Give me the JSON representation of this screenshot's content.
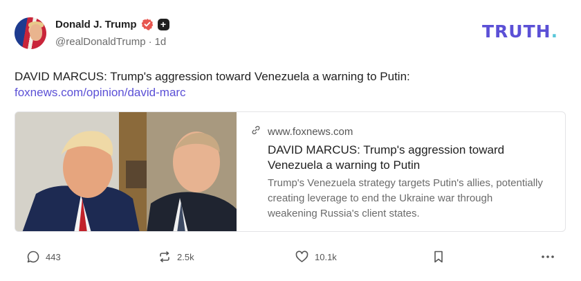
{
  "post": {
    "author_name": "Donald J. Trump",
    "handle": "@realDonaldTrump",
    "separator": "·",
    "age": "1d",
    "text": "DAVID MARCUS: Trump's aggression toward Venezuela a warning to Putin:",
    "link_text": "foxnews.com/opinion/david-marc"
  },
  "brand": {
    "name": "TRUTH",
    "dot": "."
  },
  "card": {
    "domain": "www.foxnews.com",
    "title": "DAVID MARCUS: Trump's aggression toward Venezuela a warning to Putin",
    "description": "Trump's Venezuela strategy targets Putin's allies, potentially creating leverage to end the Ukraine war through weakening Russia's client states.",
    "image_icon": "photo-two-men"
  },
  "actions": {
    "replies": "443",
    "retruths": "2.5k",
    "likes": "10.1k"
  },
  "colors": {
    "accent": "#5b50d6",
    "brand_dot": "#59c7d9",
    "verified": "#e7564f",
    "text_muted": "#6b6b6b"
  },
  "icons": {
    "verified": "verified-badge-icon",
    "plus": "plus-badge-icon",
    "link": "link-icon",
    "reply": "comment-icon",
    "retruth": "repost-icon",
    "like": "heart-icon",
    "bookmark": "bookmark-icon",
    "more": "more-icon"
  }
}
